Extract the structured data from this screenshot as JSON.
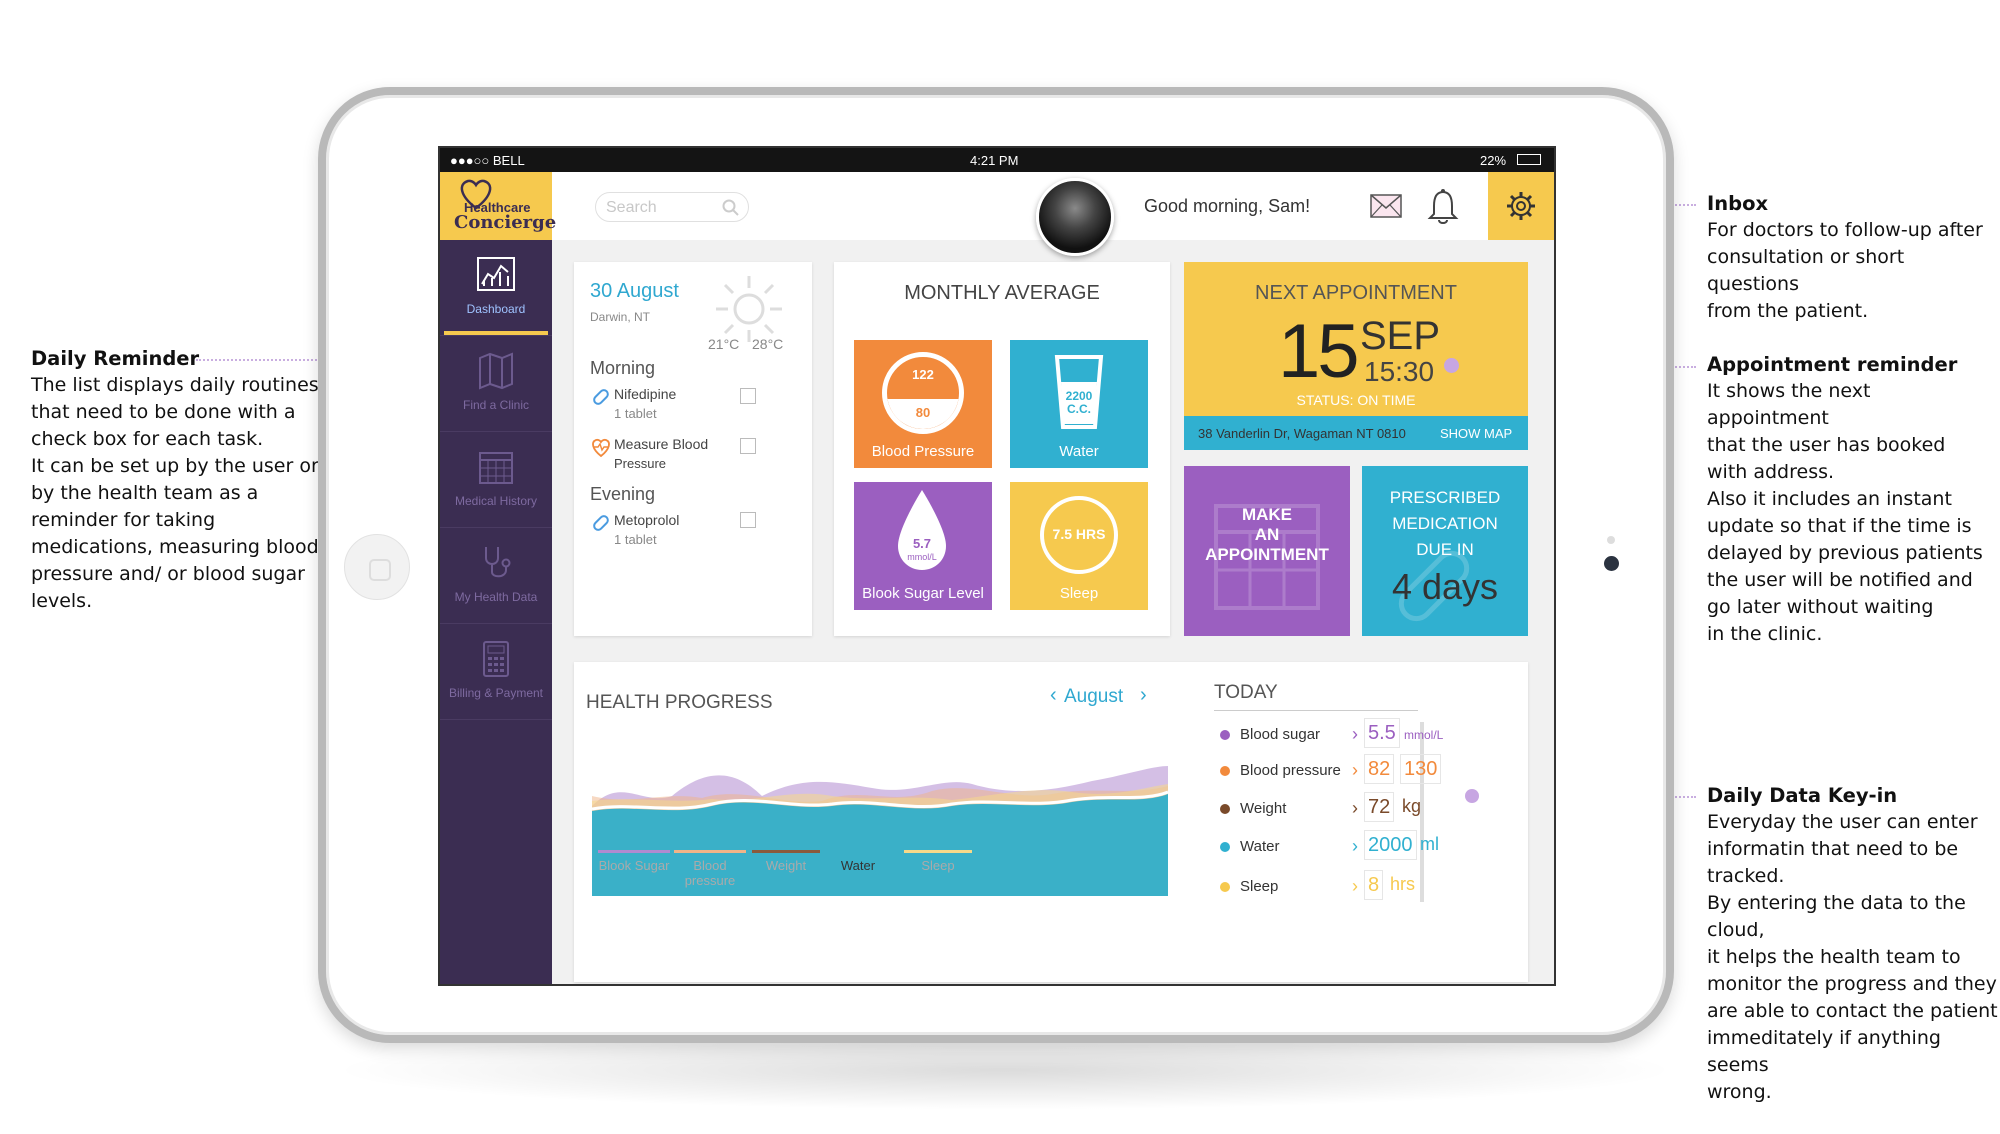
{
  "annotations": {
    "daily_reminder": {
      "title": "Daily Reminder",
      "body": "The list displays daily routines\nthat need to be done with a\ncheck box for each task.\nIt can be set up by the user or\nby the health team as a\nreminder for taking\nmedications, measuring blood\npressure and/ or blood sugar\nlevels."
    },
    "inbox": {
      "title": "Inbox",
      "body": "For doctors to follow-up after\nconsultation or short questions\nfrom the patient."
    },
    "appointment_reminder": {
      "title": "Appointment reminder",
      "body": "It shows the next appointment\nthat the user has booked\nwith address.\nAlso it includes an instant\nupdate so that if the time is\ndelayed by previous patients\nthe user will be notified and\ngo later without waiting\nin the clinic."
    },
    "daily_key_in": {
      "title": "Daily Data Key-in",
      "body": "Everyday the user can enter\ninformatin that need to be\ntracked.\nBy entering the data to the cloud,\nit helps the health team to\nmonitor the progress and they\nare able to contact the patient\nimmeditately if anything seems\nwrong."
    }
  },
  "status_bar": {
    "carrier": "●●●○○ BELL",
    "time": "4:21 PM",
    "battery": "22%"
  },
  "logo": {
    "line1": "Healthcare",
    "line2": "Concierge"
  },
  "search": {
    "placeholder": "Search"
  },
  "greeting": "Good morning, Sam!",
  "sidebar": {
    "items": [
      {
        "label": "Dashboard",
        "icon": "chart-icon"
      },
      {
        "label": "Find a Clinic",
        "icon": "map-icon"
      },
      {
        "label": "Medical History",
        "icon": "calendar-icon"
      },
      {
        "label": "My Health Data",
        "icon": "stethoscope-icon"
      },
      {
        "label": "Billing & Payment",
        "icon": "calculator-icon"
      }
    ]
  },
  "reminder": {
    "date": "30 August",
    "location": "Darwin, NT",
    "temp_low": "21°C",
    "temp_high": "28°C",
    "morning_label": "Morning",
    "evening_label": "Evening",
    "tasks": [
      {
        "name": "Nifedipine",
        "detail": "1 tablet"
      },
      {
        "name": "Measure Blood",
        "detail": "Pressure"
      },
      {
        "name": "Metoprolol",
        "detail": "1 tablet"
      }
    ]
  },
  "monthly": {
    "title": "MONTHLY AVERAGE",
    "bp_top": "122",
    "bp_bottom": "80",
    "bp_label": "Blood Pressure",
    "water_value": "2200\nC.C.",
    "water_label": "Water",
    "sugar_value": "5.7",
    "sugar_unit": "mmol/L",
    "sugar_label": "Blook Sugar Level",
    "sleep_value": "7.5 HRS",
    "sleep_label": "Sleep"
  },
  "appointment": {
    "title": "NEXT APPOINTMENT",
    "day": "15",
    "month": "SEP",
    "time": "15:30",
    "status": "STATUS: ON TIME",
    "address": "38 Vanderlin Dr, Wagaman NT 0810",
    "map": "SHOW MAP"
  },
  "make_appointment": {
    "l1": "MAKE",
    "l2": "AN",
    "l3": "APPOINTMENT"
  },
  "prescribed": {
    "l1": "PRESCRIBED",
    "l2": "MEDICATION",
    "l3": "DUE IN",
    "days": "4 days"
  },
  "progress": {
    "title": "HEALTH PROGRESS",
    "month": "August",
    "legend": [
      "Blook Sugar",
      "Blood pressure",
      "Weight",
      "Water",
      "Sleep"
    ]
  },
  "today": {
    "title": "TODAY",
    "rows": [
      {
        "name": "Blood sugar",
        "v1": "5.5",
        "unit": "mmol/L"
      },
      {
        "name": "Blood pressure",
        "v1": "82",
        "v2": "130"
      },
      {
        "name": "Weight",
        "v1": "72",
        "unit": "kg"
      },
      {
        "name": "Water",
        "v1": "2000",
        "unit": "ml"
      },
      {
        "name": "Sleep",
        "v1": "8",
        "unit": "hrs"
      }
    ]
  },
  "colors": {
    "yellow": "#f6c94e",
    "purple": "#9b5fc0",
    "teal": "#30b0d0",
    "orange": "#f28a3c",
    "navy": "#3b2d52"
  }
}
